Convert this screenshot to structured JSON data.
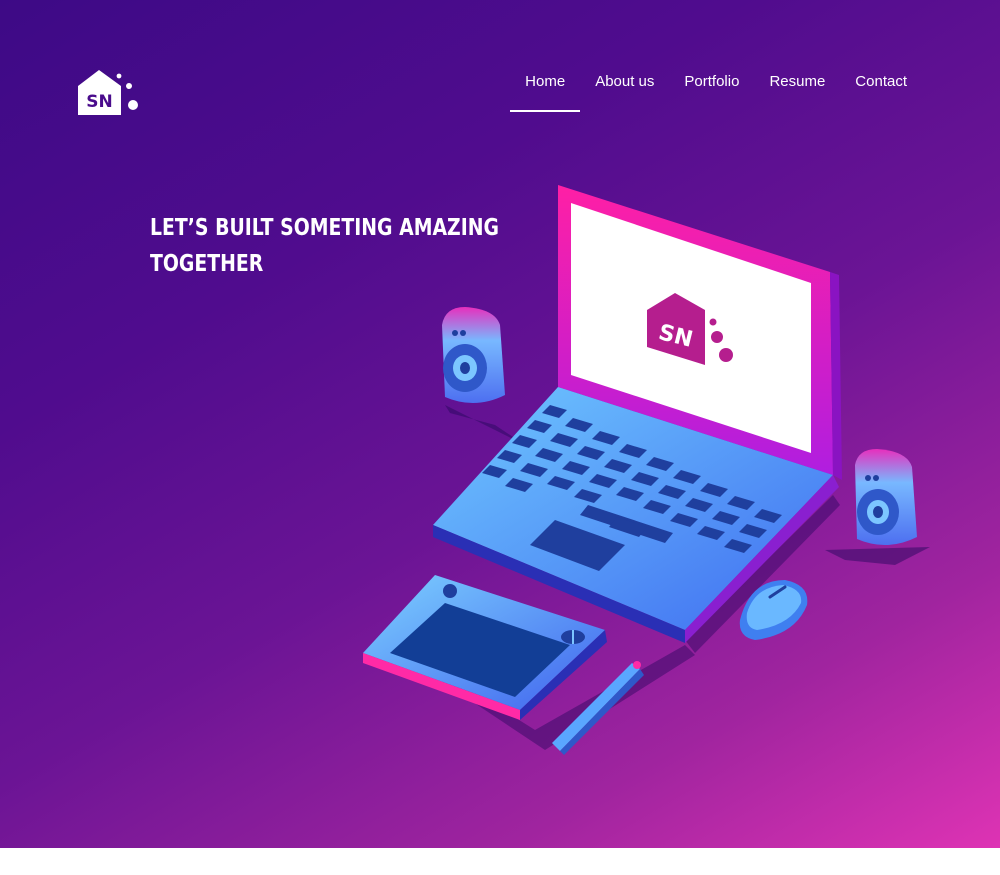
{
  "brand": {
    "logo_text": "SN",
    "logo_icon": "house-logo-icon",
    "colors": {
      "white": "#ffffff",
      "accent": "#de33b4"
    }
  },
  "nav": {
    "items": [
      {
        "label": "Home",
        "active": true
      },
      {
        "label": "About us",
        "active": false
      },
      {
        "label": "Portfolio",
        "active": false
      },
      {
        "label": "Resume",
        "active": false
      },
      {
        "label": "Contact",
        "active": false
      }
    ]
  },
  "hero": {
    "headline_line1": "LET’S BUILT SOMETING AMAZING",
    "headline_line2": "TOGETHER",
    "illustration": "isometric-laptop-workspace",
    "screen_logo_text": "SN"
  }
}
